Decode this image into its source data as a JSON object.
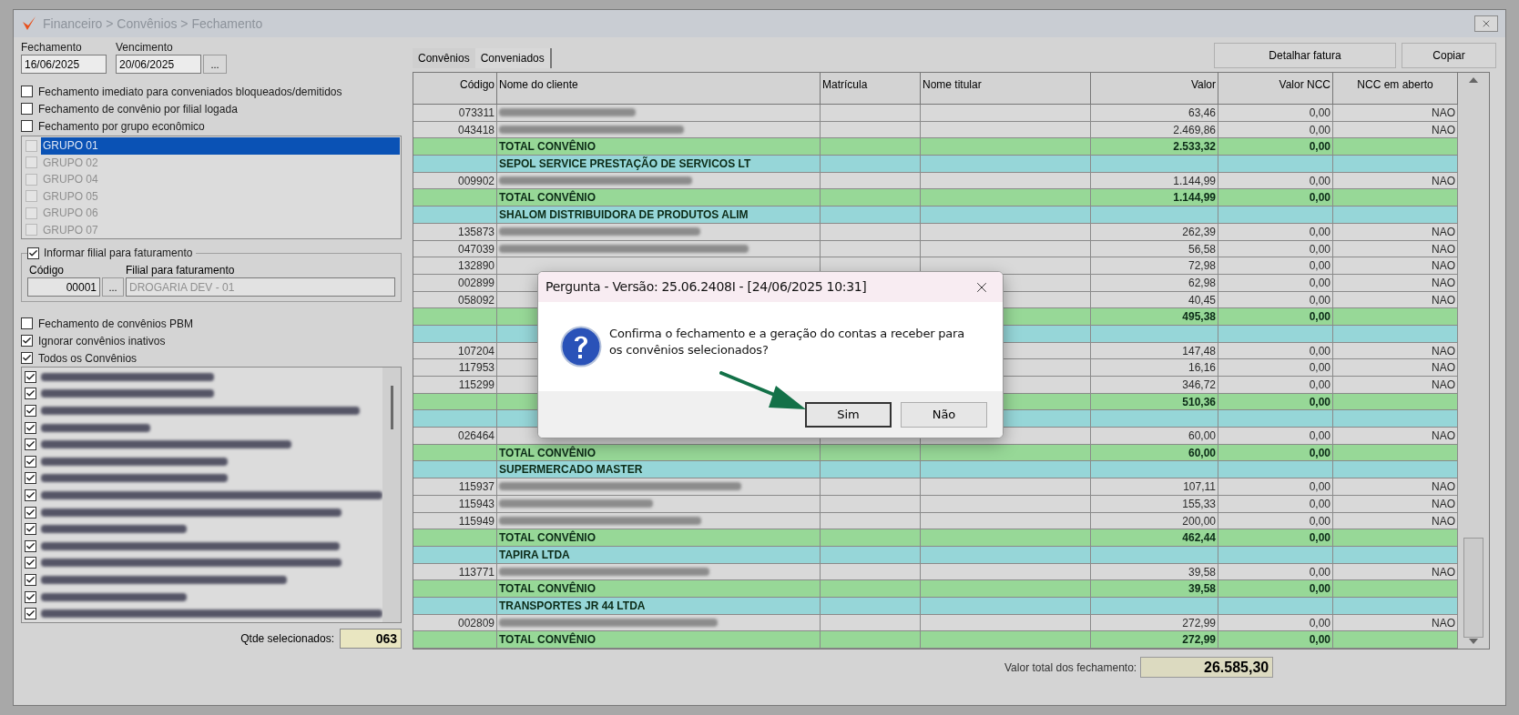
{
  "window": {
    "title": "Financeiro > Convênios > Fechamento"
  },
  "dates": [
    {
      "label": "Fechamento",
      "value": "16/06/2025"
    },
    {
      "label": "Vencimento",
      "value": "20/06/2025",
      "picker": "..."
    }
  ],
  "options_top": [
    {
      "label": "Fechamento imediato para conveniados bloqueados/demitidos",
      "checked": false
    },
    {
      "label": "Fechamento de convênio por filial logada",
      "checked": false
    },
    {
      "label": "Fechamento por grupo econômico",
      "checked": false
    }
  ],
  "groups": [
    {
      "label": "GRUPO 01",
      "selected": true,
      "checked": false
    },
    {
      "label": "GRUPO 02",
      "selected": false,
      "checked": false
    },
    {
      "label": "GRUPO 04",
      "selected": false,
      "checked": false
    },
    {
      "label": "GRUPO 05",
      "selected": false,
      "checked": false
    },
    {
      "label": "GRUPO 06",
      "selected": false,
      "checked": false
    },
    {
      "label": "GRUPO 07",
      "selected": false,
      "checked": false
    }
  ],
  "billing_branch": {
    "label": "Informar filial para faturamento",
    "checked": true,
    "code_label": "Código",
    "code": "00001",
    "picker": "...",
    "branch_label": "Filial para faturamento",
    "branch": "DROGARIA DEV - 01"
  },
  "options_bottom": [
    {
      "label": "Fechamento de convênios PBM",
      "checked": false
    },
    {
      "label": "Ignorar convênios inativos",
      "checked": true
    },
    {
      "label": "Todos os Convênios",
      "checked": true
    }
  ],
  "convenios": [
    {
      "checked": true
    },
    {
      "checked": true
    },
    {
      "checked": true
    },
    {
      "checked": true
    },
    {
      "checked": true
    },
    {
      "checked": true
    },
    {
      "checked": true
    },
    {
      "checked": true
    },
    {
      "checked": true
    },
    {
      "checked": true
    },
    {
      "checked": true
    },
    {
      "checked": true
    },
    {
      "checked": true
    },
    {
      "checked": true
    },
    {
      "checked": true
    }
  ],
  "selected_count": {
    "label": "Qtde selecionados:",
    "value": "063"
  },
  "tabs": [
    {
      "label": "Convênios",
      "selected": false
    },
    {
      "label": "Conveniados",
      "selected": true
    }
  ],
  "buttons": [
    "Detalhar fatura",
    "Copiar"
  ],
  "table": {
    "columns": [
      "Código",
      "Nome do cliente",
      "Matrícula",
      "Nome titular",
      "Valor",
      "Valor NCC",
      "NCC em aberto"
    ],
    "rows": [
      {
        "kind": "client",
        "code": "073311",
        "value": "63,46",
        "ncc_value": "0,00",
        "ncc_open": "NAO"
      },
      {
        "kind": "client",
        "code": "043418",
        "value": "2.469,86",
        "ncc_value": "0,00",
        "ncc_open": "NAO"
      },
      {
        "kind": "total",
        "name": "TOTAL CONVÊNIO",
        "value": "2.533,32",
        "ncc_value": "0,00"
      },
      {
        "kind": "group",
        "name": "SEPOL SERVICE PRESTAÇÃO DE SERVICOS LT"
      },
      {
        "kind": "client",
        "code": "009902",
        "value": "1.144,99",
        "ncc_value": "0,00",
        "ncc_open": "NAO"
      },
      {
        "kind": "total",
        "name": "TOTAL CONVÊNIO",
        "value": "1.144,99",
        "ncc_value": "0,00"
      },
      {
        "kind": "group",
        "name": "SHALOM DISTRIBUIDORA DE PRODUTOS ALIM"
      },
      {
        "kind": "client",
        "code": "135873",
        "value": "262,39",
        "ncc_value": "0,00",
        "ncc_open": "NAO"
      },
      {
        "kind": "client",
        "code": "047039",
        "value": "56,58",
        "ncc_value": "0,00",
        "ncc_open": "NAO"
      },
      {
        "kind": "client",
        "code": "132890",
        "value": "72,98",
        "ncc_value": "0,00",
        "ncc_open": "NAO"
      },
      {
        "kind": "client",
        "code": "002899",
        "value": "62,98",
        "ncc_value": "0,00",
        "ncc_open": "NAO"
      },
      {
        "kind": "client",
        "code": "058092",
        "value": "40,45",
        "ncc_value": "0,00",
        "ncc_open": "NAO"
      },
      {
        "kind": "total",
        "value": "495,38",
        "ncc_value": "0,00"
      },
      {
        "kind": "group"
      },
      {
        "kind": "client",
        "code": "107204",
        "value": "147,48",
        "ncc_value": "0,00",
        "ncc_open": "NAO"
      },
      {
        "kind": "client",
        "code": "117953",
        "value": "16,16",
        "ncc_value": "0,00",
        "ncc_open": "NAO"
      },
      {
        "kind": "client",
        "code": "115299",
        "value": "346,72",
        "ncc_value": "0,00",
        "ncc_open": "NAO"
      },
      {
        "kind": "total",
        "value": "510,36",
        "ncc_value": "0,00"
      },
      {
        "kind": "group"
      },
      {
        "kind": "client",
        "code": "026464",
        "value": "60,00",
        "ncc_value": "0,00",
        "ncc_open": "NAO"
      },
      {
        "kind": "total",
        "name": "TOTAL CONVÊNIO",
        "value": "60,00",
        "ncc_value": "0,00"
      },
      {
        "kind": "group",
        "name": "SUPERMERCADO MASTER"
      },
      {
        "kind": "client",
        "code": "115937",
        "value": "107,11",
        "ncc_value": "0,00",
        "ncc_open": "NAO"
      },
      {
        "kind": "client",
        "code": "115943",
        "value": "155,33",
        "ncc_value": "0,00",
        "ncc_open": "NAO"
      },
      {
        "kind": "client",
        "code": "115949",
        "value": "200,00",
        "ncc_value": "0,00",
        "ncc_open": "NAO"
      },
      {
        "kind": "total",
        "name": "TOTAL CONVÊNIO",
        "value": "462,44",
        "ncc_value": "0,00"
      },
      {
        "kind": "group",
        "name": "TAPIRA LTDA"
      },
      {
        "kind": "client",
        "code": "113771",
        "value": "39,58",
        "ncc_value": "0,00",
        "ncc_open": "NAO"
      },
      {
        "kind": "total",
        "name": "TOTAL CONVÊNIO",
        "value": "39,58",
        "ncc_value": "0,00"
      },
      {
        "kind": "group",
        "name": "TRANSPORTES JR 44 LTDA"
      },
      {
        "kind": "client",
        "code": "002809",
        "value": "272,99",
        "ncc_value": "0,00",
        "ncc_open": "NAO"
      },
      {
        "kind": "total",
        "name": "TOTAL CONVÊNIO",
        "value": "272,99",
        "ncc_value": "0,00"
      }
    ]
  },
  "grand_total": {
    "label": "Valor total dos fechamento:",
    "value": "26.585,30"
  },
  "dialog": {
    "title": "Pergunta - Versão: 25.06.2408I - [24/06/2025 10:31]",
    "message": "Confirma o fechamento e a geração do contas a receber para os convênios selecionados?",
    "buttons": [
      {
        "label": "Sim",
        "selected": true
      },
      {
        "label": "Não",
        "selected": false
      }
    ]
  }
}
